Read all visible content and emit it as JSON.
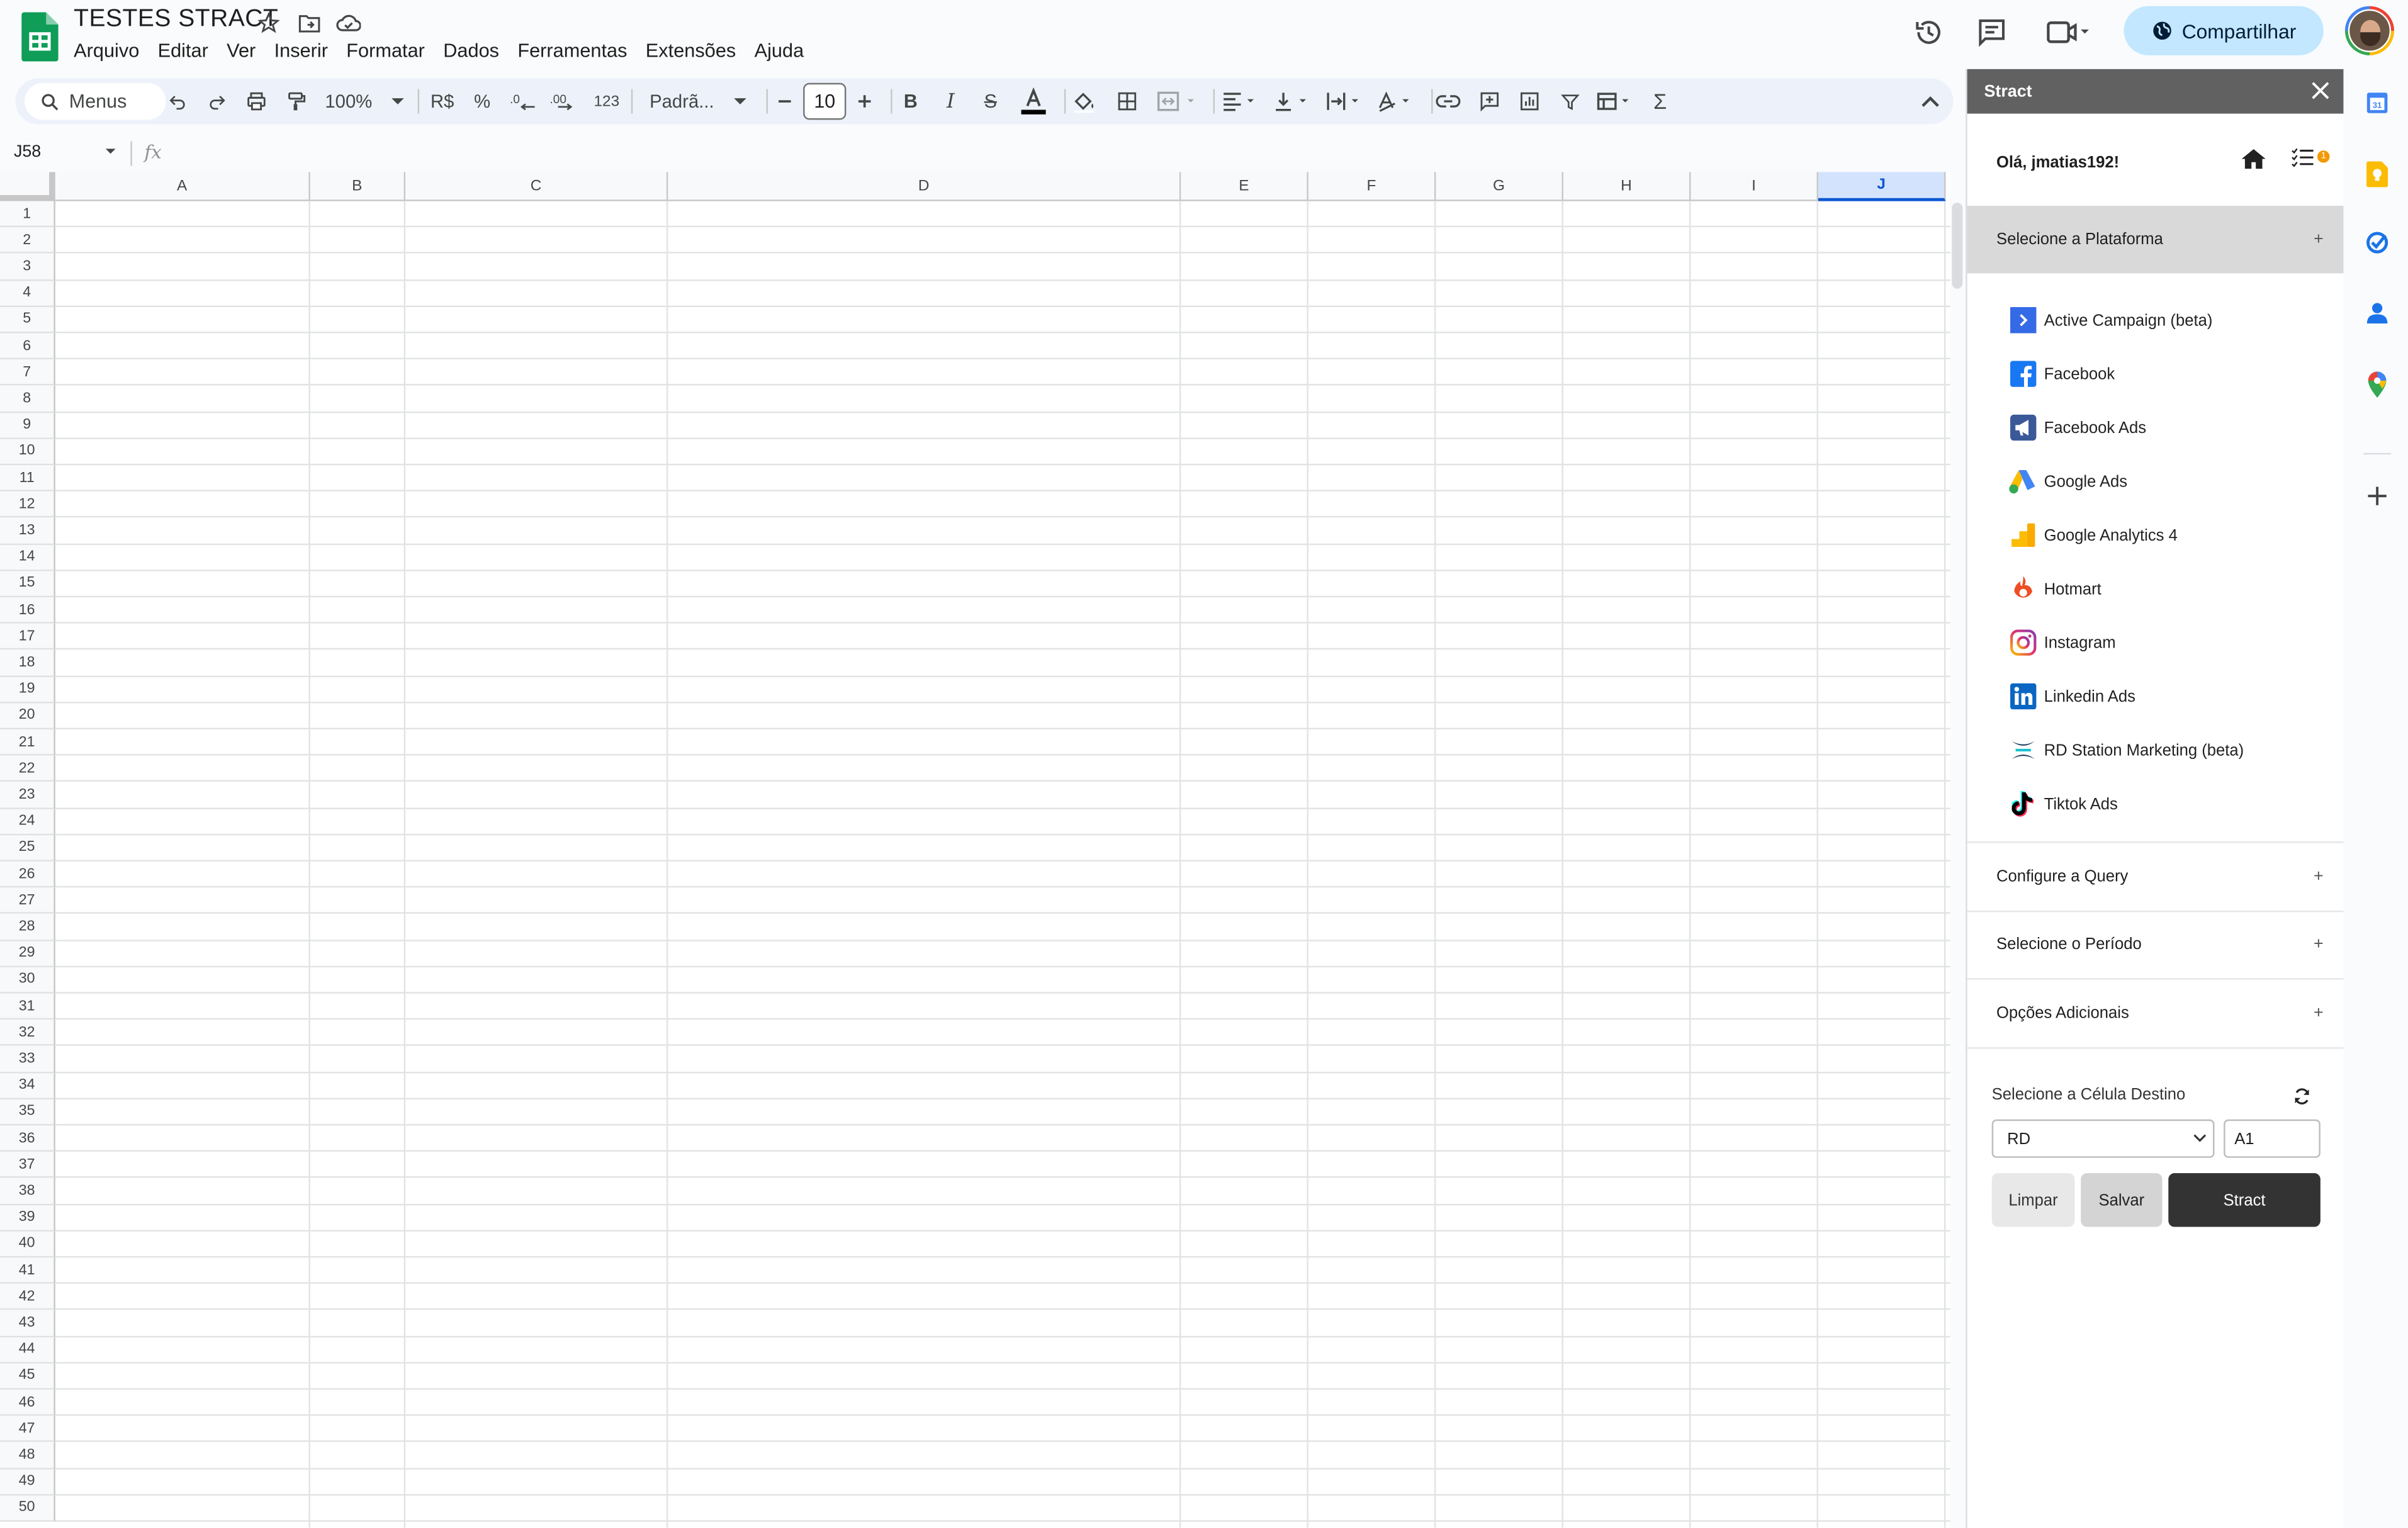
{
  "document": {
    "title": "TESTES STRACT"
  },
  "menu": [
    "Arquivo",
    "Editar",
    "Ver",
    "Inserir",
    "Formatar",
    "Dados",
    "Ferramentas",
    "Extensões",
    "Ajuda"
  ],
  "share_label": "Compartilhar",
  "toolbar": {
    "search_placeholder": "Menus",
    "zoom": "100%",
    "currency": "R$",
    "percent": "%",
    "decrease_decimals": ".0",
    "increase_decimals": ".00",
    "number_format": "123",
    "font": "Padrã...",
    "font_size": "10"
  },
  "formula_bar": {
    "name_box": "J58",
    "fx": "fx"
  },
  "grid": {
    "columns": [
      "A",
      "B",
      "C",
      "D",
      "E",
      "F",
      "G",
      "H",
      "I",
      "J"
    ],
    "selected_column": "J",
    "rows": [
      "1",
      "2",
      "3",
      "4",
      "5",
      "6",
      "7",
      "8",
      "9",
      "10",
      "11",
      "12",
      "13",
      "14",
      "15",
      "16",
      "17",
      "18",
      "19",
      "20",
      "21",
      "22",
      "23",
      "24",
      "25",
      "26",
      "27",
      "28",
      "29",
      "30",
      "31",
      "32",
      "33",
      "34",
      "35",
      "36",
      "37",
      "38",
      "39",
      "40",
      "41",
      "42",
      "43",
      "44",
      "45",
      "46",
      "47",
      "48",
      "49",
      "50"
    ]
  },
  "panel": {
    "title": "Stract",
    "greeting": "Olá, jmatias192!",
    "notification_count": "1",
    "platform_section": "Selecione a Plataforma",
    "platforms": [
      {
        "label": "Active Campaign (beta)",
        "icon": "active-campaign-icon"
      },
      {
        "label": "Facebook",
        "icon": "facebook-icon"
      },
      {
        "label": "Facebook Ads",
        "icon": "facebook-ads-icon"
      },
      {
        "label": "Google Ads",
        "icon": "google-ads-icon"
      },
      {
        "label": "Google Analytics 4",
        "icon": "google-analytics-icon"
      },
      {
        "label": "Hotmart",
        "icon": "hotmart-icon"
      },
      {
        "label": "Instagram",
        "icon": "instagram-icon"
      },
      {
        "label": "Linkedin Ads",
        "icon": "linkedin-icon"
      },
      {
        "label": "RD Station Marketing (beta)",
        "icon": "rd-station-icon"
      },
      {
        "label": "Tiktok Ads",
        "icon": "tiktok-icon"
      }
    ],
    "sections": [
      "Configure a Query",
      "Selecione o Período",
      "Opções Adicionais"
    ],
    "destination_label": "Selecione a Célula Destino",
    "sheet_select": "RD",
    "cell_input": "A1",
    "buttons": {
      "clear": "Limpar",
      "save": "Salvar",
      "run": "Stract"
    }
  },
  "colors": {
    "accent": "#0b57d0",
    "share_bg": "#c2e7ff",
    "panel_header": "#616161",
    "run_button": "#333333"
  }
}
